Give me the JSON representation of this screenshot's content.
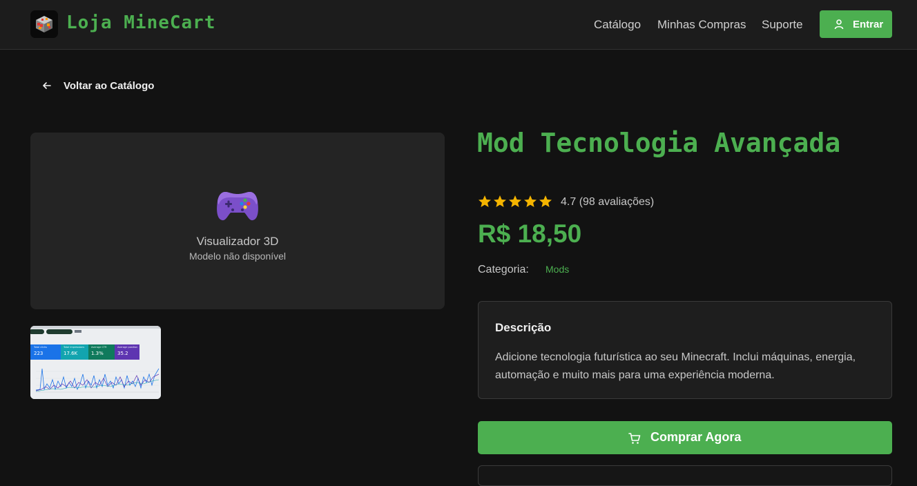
{
  "header": {
    "logo_text": "Loja MineCart",
    "nav": [
      "Catálogo",
      "Minhas Compras",
      "Suporte"
    ],
    "login_label": "Entrar"
  },
  "back": {
    "label": "Voltar ao Catálogo"
  },
  "viewer": {
    "title": "Visualizador 3D",
    "subtitle": "Modelo não disponível",
    "icon": "gamepad-icon"
  },
  "thumbnail": {
    "stats": [
      {
        "label": "Total clicks",
        "value": "223",
        "color": "#1a73e8"
      },
      {
        "label": "Total impressions",
        "value": "17.6K",
        "color": "#12a4af"
      },
      {
        "label": "Average CTR",
        "value": "1.3%",
        "color": "#0f7a5c"
      },
      {
        "label": "Average position",
        "value": "35.2",
        "color": "#5e35b1"
      }
    ]
  },
  "product": {
    "title": "Mod Tecnologia Avançada",
    "stars": 5,
    "rating_text": "4.7 (98 avaliações)",
    "price": "R$ 18,50",
    "category_label": "Categoria:",
    "category_value": "Mods",
    "description_heading": "Descrição",
    "description": "Adicione tecnologia futurística ao seu Minecraft. Inclui máquinas, energia, automação e muito mais para uma experiência moderna.",
    "buy_label": "Comprar Agora"
  },
  "colors": {
    "accent": "#4caf50",
    "background": "#121212",
    "surface": "#242424",
    "star": "#f4b400"
  }
}
